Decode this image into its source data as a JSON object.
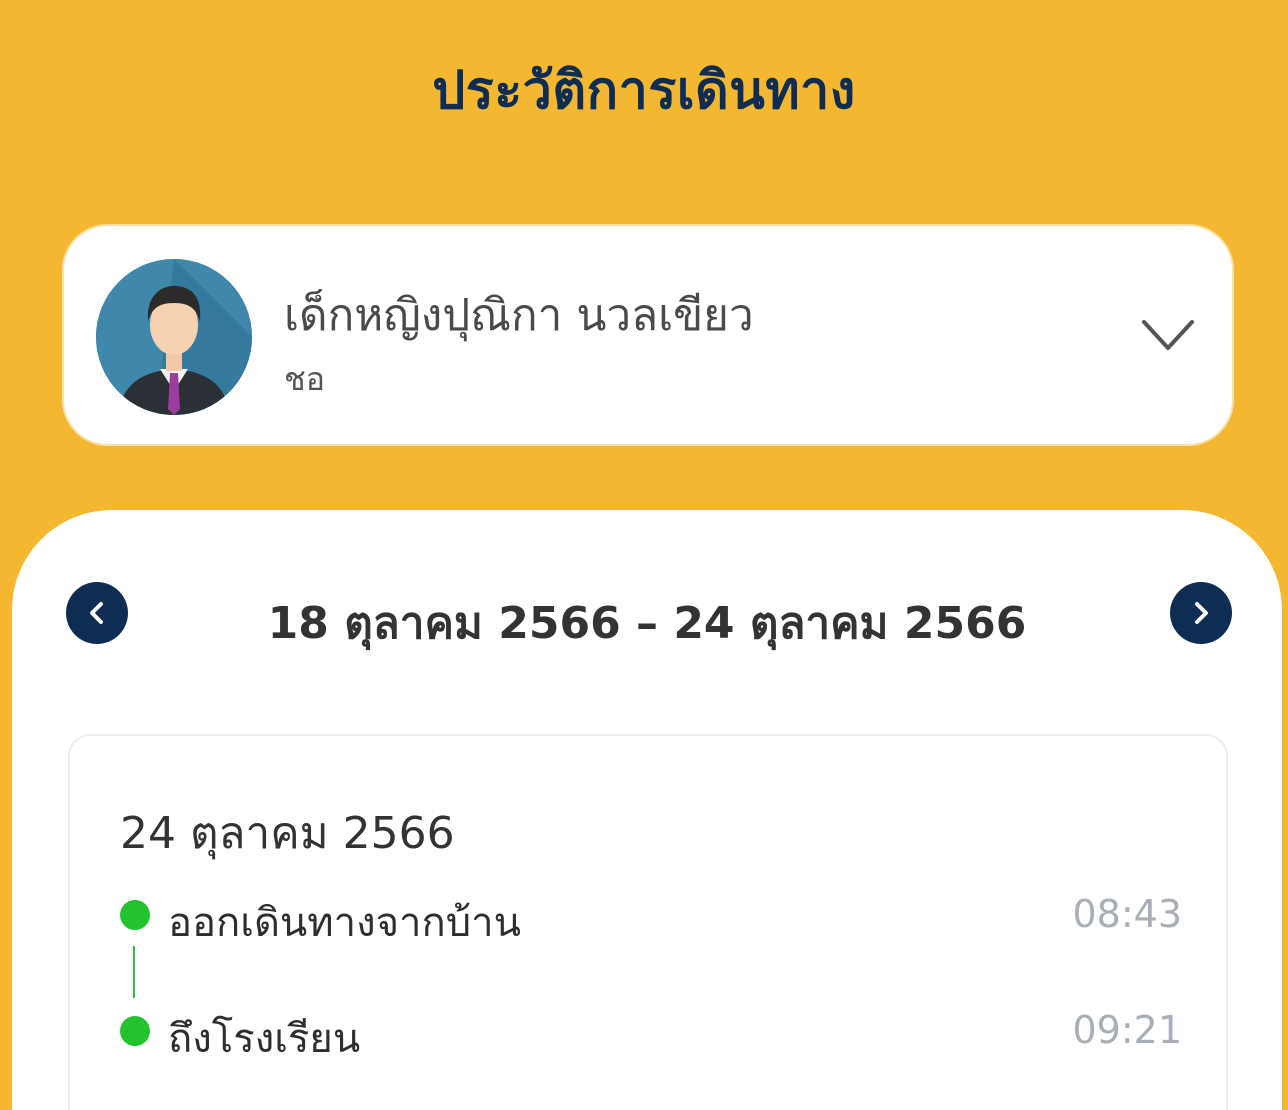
{
  "header": {
    "title": "ประวัติการเดินทาง"
  },
  "profile": {
    "name": "เด็กหญิงปุณิกา นวลเขียว",
    "nickname": "ชอ",
    "avatar_icon": "businessman-avatar-icon",
    "dropdown_icon": "chevron-down-icon"
  },
  "history": {
    "date_range": "18 ตุลาคม 2566 – 24 ตุลาคม 2566",
    "prev_icon": "chevron-left-icon",
    "next_icon": "chevron-right-icon",
    "days": [
      {
        "date": "24 ตุลาคม 2566",
        "events": [
          {
            "label": "ออกเดินทางจากบ้าน",
            "time": "08:43"
          },
          {
            "label": "ถึงโรงเรียน",
            "time": "09:21"
          }
        ]
      }
    ]
  },
  "colors": {
    "header_background": "#f4b731",
    "title_color": "#0f2c52",
    "nav_button": "#0f2c52",
    "status_dot": "#22c32e",
    "time_text": "#a9afb6"
  }
}
